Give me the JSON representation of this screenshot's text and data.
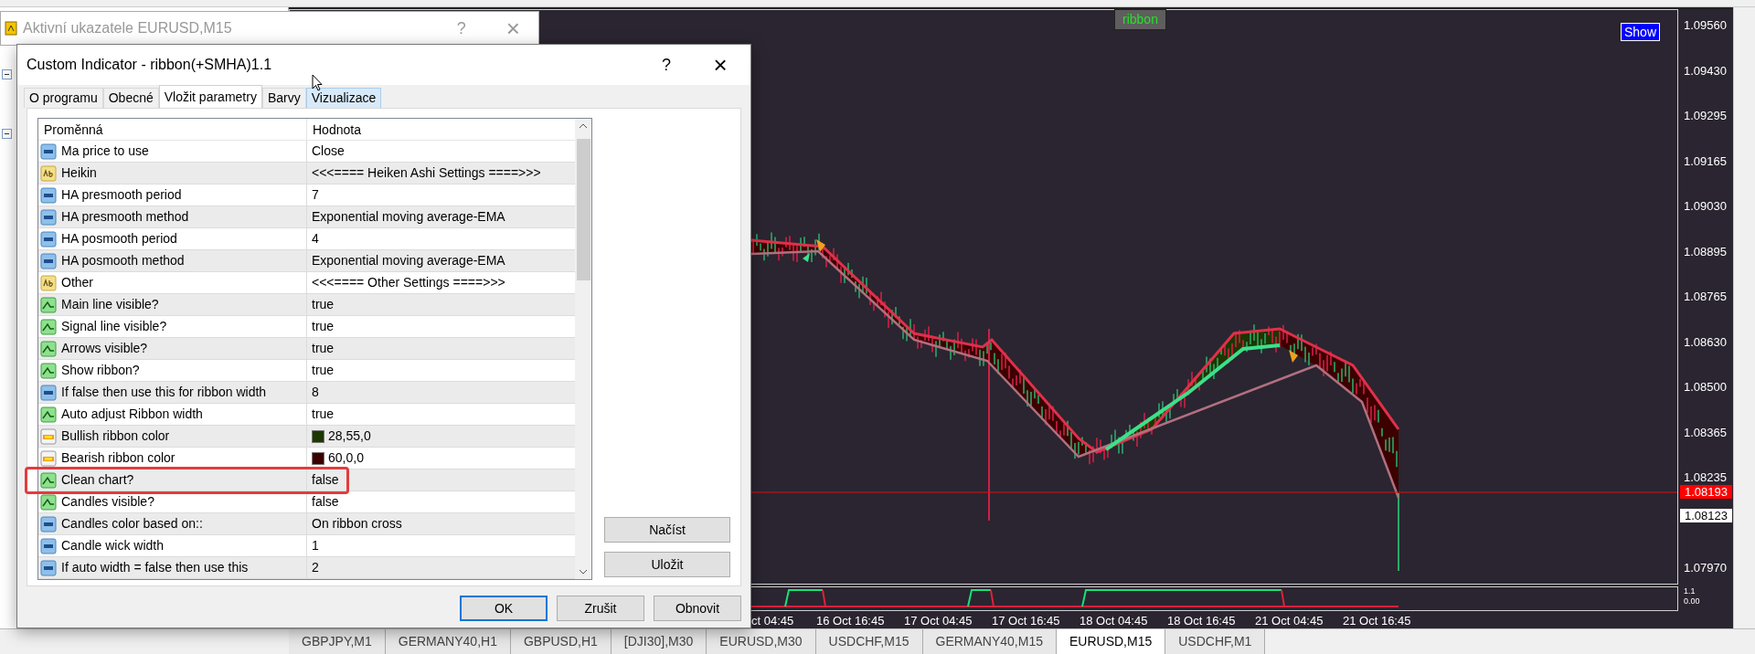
{
  "background_window": {
    "title": "Aktivní ukazatele EURUSD,M15",
    "help": "?",
    "close": "×"
  },
  "dialog": {
    "title": "Custom Indicator - ribbon(+SMHA)1.1",
    "help": "?",
    "close": "×",
    "tabs": [
      {
        "label": "O programu",
        "selected": false,
        "hovered": false
      },
      {
        "label": "Obecné",
        "selected": false,
        "hovered": false
      },
      {
        "label": "Vložit parametry",
        "selected": true,
        "hovered": false
      },
      {
        "label": "Barvy",
        "selected": false,
        "hovered": false
      },
      {
        "label": "Vizualizace",
        "selected": false,
        "hovered": true
      }
    ],
    "table": {
      "columns": [
        "Proměnná",
        "Hodnota"
      ],
      "rows": [
        {
          "kind": "number",
          "name": "Ma price to use",
          "value": "Close",
          "highlighted": false
        },
        {
          "kind": "text",
          "name": "Heikin",
          "value": "<<<====  Heiken Ashi Settings ====>>>",
          "highlighted": false
        },
        {
          "kind": "number",
          "name": "HA presmooth period",
          "value": "7",
          "highlighted": false
        },
        {
          "kind": "number",
          "name": "HA presmooth method",
          "value": "Exponential moving average-EMA",
          "highlighted": false
        },
        {
          "kind": "number",
          "name": "HA posmooth period",
          "value": "4",
          "highlighted": false
        },
        {
          "kind": "number",
          "name": "HA posmooth method",
          "value": "Exponential moving average-EMA",
          "highlighted": false
        },
        {
          "kind": "text",
          "name": "Other",
          "value": "<<<====  Other Settings ====>>>",
          "highlighted": false
        },
        {
          "kind": "bool",
          "name": "Main line visible?",
          "value": "true",
          "highlighted": false
        },
        {
          "kind": "bool",
          "name": "Signal line visible?",
          "value": "true",
          "highlighted": false
        },
        {
          "kind": "bool",
          "name": "Arrows visible?",
          "value": "true",
          "highlighted": false
        },
        {
          "kind": "bool",
          "name": "Show ribbon?",
          "value": "true",
          "highlighted": false
        },
        {
          "kind": "number",
          "name": "If  false then use this for ribbon width",
          "value": "8",
          "highlighted": false
        },
        {
          "kind": "bool",
          "name": "Auto adjust Ribbon width",
          "value": "true",
          "highlighted": false
        },
        {
          "kind": "color",
          "name": "Bullish ribbon  color",
          "value": "28,55,0",
          "color": "#1c3700",
          "highlighted": false
        },
        {
          "kind": "color",
          "name": "Bearish ribbon  color",
          "value": "60,0,0",
          "color": "#3c0000",
          "highlighted": false
        },
        {
          "kind": "bool",
          "name": "Clean chart?",
          "value": "false",
          "highlighted": true
        },
        {
          "kind": "bool",
          "name": "Candles visible?",
          "value": "false",
          "highlighted": false
        },
        {
          "kind": "number",
          "name": "Candles color based on::",
          "value": "On ribbon cross",
          "highlighted": false
        },
        {
          "kind": "number",
          "name": "Candle wick width",
          "value": "1",
          "highlighted": false
        },
        {
          "kind": "number",
          "name": "If auto width = false then use this",
          "value": "2",
          "highlighted": false
        }
      ]
    },
    "side_buttons": [
      "Načíst",
      "Uložit"
    ],
    "buttons": [
      {
        "label": "OK",
        "default": true
      },
      {
        "label": "Zrušit",
        "default": false
      },
      {
        "label": "Obnovit",
        "default": false
      }
    ]
  },
  "chart": {
    "indicator_label": "ribbon",
    "show_button": "Show",
    "price_ticks": [
      "1.09560",
      "1.09430",
      "1.09295",
      "1.09165",
      "1.09030",
      "1.08895",
      "1.08765",
      "1.08630",
      "1.08500",
      "1.08365",
      "1.08235",
      "1.07970"
    ],
    "bid_price": "1.08193",
    "ask_price": "1.08123",
    "subwindow_ticks": [
      "1.1",
      "0.00"
    ],
    "time_ticks": [
      "ct 04:45",
      "16 Oct 16:45",
      "17 Oct 04:45",
      "17 Oct 16:45",
      "18 Oct 04:45",
      "18 Oct 16:45",
      "21 Oct 04:45",
      "21 Oct 16:45"
    ]
  },
  "symbol_tabs": [
    {
      "label": "GBPJPY,M1",
      "selected": false
    },
    {
      "label": "GERMANY40,H1",
      "selected": false
    },
    {
      "label": "GBPUSD,H1",
      "selected": false
    },
    {
      "label": "[DJI30],M30",
      "selected": false
    },
    {
      "label": "EURUSD,M30",
      "selected": false
    },
    {
      "label": "USDCHF,M15",
      "selected": false
    },
    {
      "label": "GERMANY40,M15",
      "selected": false
    },
    {
      "label": "EURUSD,M15",
      "selected": true
    },
    {
      "label": "USDCHF,M1",
      "selected": false
    }
  ]
}
